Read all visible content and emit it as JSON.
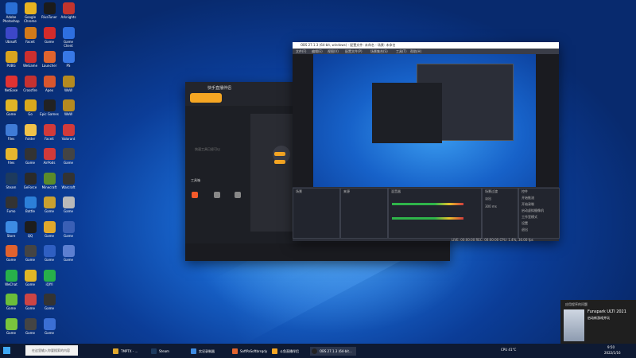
{
  "desktop": {
    "icons": [
      {
        "label": "Adobe Photoshop",
        "color": "#2a6fd6"
      },
      {
        "label": "Google Chrome",
        "color": "#e8b321"
      },
      {
        "label": "RivaTuner",
        "color": "#1b1b1b"
      },
      {
        "label": "Arknights",
        "color": "#c2342d"
      },
      {
        "label": "Ubisoft",
        "color": "#3c47c9"
      },
      {
        "label": "Faceit",
        "color": "#d27a1a"
      },
      {
        "label": "Game",
        "color": "#d32b2b"
      },
      {
        "label": "Game Client",
        "color": "#2e6fe0"
      },
      {
        "label": "PUBG",
        "color": "#d9a420"
      },
      {
        "label": "WeGame",
        "color": "#cc2f2f"
      },
      {
        "label": "Launcher",
        "color": "#e0642e"
      },
      {
        "label": "PS",
        "color": "#3878e6"
      },
      {
        "label": "NetEase",
        "color": "#e03232"
      },
      {
        "label": "Crossfire",
        "color": "#c53131"
      },
      {
        "label": "Apex",
        "color": "#d8562e"
      },
      {
        "label": "WoW",
        "color": "#b58a20"
      },
      {
        "label": "Game",
        "color": "#e0b526"
      },
      {
        "label": "Go",
        "color": "#d8a81d"
      },
      {
        "label": "Epic Games",
        "color": "#222"
      },
      {
        "label": "WoW",
        "color": "#b58a20"
      },
      {
        "label": "Files",
        "color": "#3f7bd6"
      },
      {
        "label": "Folder",
        "color": "#f1c24a"
      },
      {
        "label": "Faceit",
        "color": "#d23a3a"
      },
      {
        "label": "Valorant",
        "color": "#d23a3a"
      },
      {
        "label": "Files",
        "color": "#e6b62e"
      },
      {
        "label": "Game",
        "color": "#333"
      },
      {
        "label": "AirPods",
        "color": "#d23a3a"
      },
      {
        "label": "Game",
        "color": "#444"
      },
      {
        "label": "Steam",
        "color": "#1d3a5e"
      },
      {
        "label": "GeForce",
        "color": "#2a2a2a"
      },
      {
        "label": "Minecraft",
        "color": "#5b8b2a"
      },
      {
        "label": "Warcraft",
        "color": "#333"
      },
      {
        "label": "Fumo",
        "color": "#333"
      },
      {
        "label": "Battle",
        "color": "#2c7fd8"
      },
      {
        "label": "Game",
        "color": "#c9a030"
      },
      {
        "label": "Game",
        "color": "#b9b9b9"
      },
      {
        "label": "Store",
        "color": "#3d8be3"
      },
      {
        "label": "QQ",
        "color": "#1d1d1d"
      },
      {
        "label": "Game",
        "color": "#e0a82c"
      },
      {
        "label": "Game",
        "color": "#3a5fb5"
      },
      {
        "label": "Game",
        "color": "#e0622e"
      },
      {
        "label": "Game",
        "color": "#444"
      },
      {
        "label": "Game",
        "color": "#2f5fc2"
      },
      {
        "label": "Game",
        "color": "#5c7fd1"
      },
      {
        "label": "WeChat",
        "color": "#27b04a"
      },
      {
        "label": "Game",
        "color": "#e0b526"
      },
      {
        "label": "iQIYI",
        "color": "#27b04a"
      },
      {
        "label": "",
        "color": ""
      },
      {
        "label": "Game",
        "color": "#6bbf3a"
      },
      {
        "label": "Game",
        "color": "#c44"
      },
      {
        "label": "Game",
        "color": "#333"
      },
      {
        "label": "",
        "color": ""
      },
      {
        "label": "Game",
        "color": "#7ac43d"
      },
      {
        "label": "Game",
        "color": "#444"
      },
      {
        "label": "Game",
        "color": "#3b6fd4"
      },
      {
        "label": "",
        "color": ""
      }
    ]
  },
  "kuaishou": {
    "app_name": "快手直播伴侣",
    "tools_label": "工具箱",
    "status_text": "快速工具已经可以"
  },
  "obs": {
    "title": "OBS 27.1.3 (64-bit, windows) - 配置文件: 未命名 - 场景: 未命名",
    "menu": [
      "文件(F)",
      "编辑(E)",
      "视图(V)",
      "配置文件(P)",
      "场景集合(S)",
      "工具(T)",
      "帮助(H)"
    ],
    "panels": [
      "场景",
      "来源",
      "混音器",
      "场景过渡",
      "控件"
    ],
    "controls": [
      "开始推流",
      "开始录制",
      "启动虚拟摄像机",
      "工作室模式",
      "设置",
      "退出"
    ],
    "transition": "淡出",
    "duration": "300 ms",
    "status": "LIVE: 00:00:00  REC: 00:00:00  CPU: 1.4%, 30.00 fps"
  },
  "notification": {
    "header": "应用程序的问题",
    "title": "Funspark ULTI 2021",
    "subtitle": "启动新游戏并玩"
  },
  "taskbar": {
    "search_placeholder": "在这里输入你要搜索的内容",
    "items": [
      "TMPTX - ...",
      "Steam",
      "实况录制器",
      "SoftPaSoftbrsqdy",
      "斗鱼直播伴侣",
      "OBS 27.1.3 (64-bit..."
    ],
    "time": "9:50",
    "date": "2022/1/16",
    "tray_text": "CPU 41°C"
  }
}
